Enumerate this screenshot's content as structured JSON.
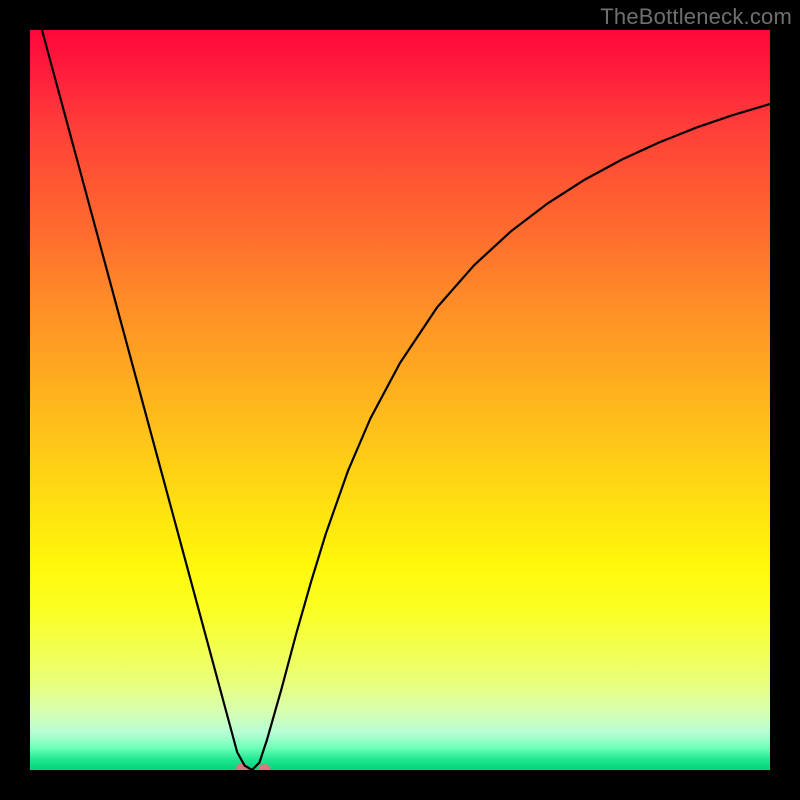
{
  "watermark": "TheBottleneck.com",
  "chart_data": {
    "type": "line",
    "title": "",
    "xlabel": "",
    "ylabel": "",
    "xlim": [
      0,
      100
    ],
    "ylim": [
      0,
      100
    ],
    "grid": false,
    "legend": false,
    "background_gradient": [
      {
        "pos": 0,
        "color": "#ff073a"
      },
      {
        "pos": 50,
        "color": "#ffb81a"
      },
      {
        "pos": 80,
        "color": "#fff70a"
      },
      {
        "pos": 100,
        "color": "#00d47a"
      }
    ],
    "series": [
      {
        "name": "bottleneck-curve",
        "color": "#000000",
        "x": [
          0,
          3,
          6,
          9,
          12,
          15,
          18,
          21,
          24,
          27,
          28,
          29,
          30,
          31,
          32,
          34,
          36,
          38,
          40,
          43,
          46,
          50,
          55,
          60,
          65,
          70,
          75,
          80,
          85,
          90,
          95,
          100
        ],
        "y": [
          106,
          94.9,
          83.8,
          72.7,
          61.6,
          50.5,
          39.4,
          28.3,
          17.2,
          6.1,
          2.4,
          0.6,
          0,
          1,
          4,
          11,
          18.5,
          25.5,
          32,
          40.5,
          47.5,
          55,
          62.5,
          68.2,
          72.8,
          76.6,
          79.8,
          82.5,
          84.8,
          86.8,
          88.5,
          90
        ]
      }
    ],
    "marker": {
      "name": "optimal-point",
      "x": 28.7,
      "y": 0,
      "radius_primary": 7,
      "radius_secondary": 6,
      "offset_secondary_x": 3,
      "color": "#d9787f"
    }
  }
}
